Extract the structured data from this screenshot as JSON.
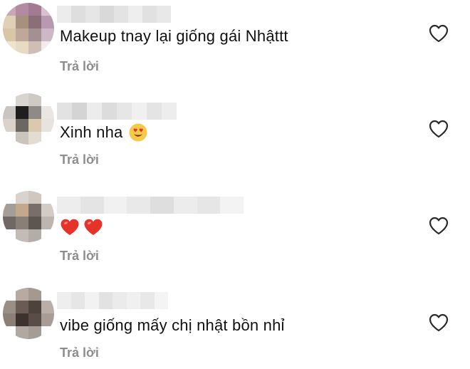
{
  "comments": [
    {
      "text": "Makeup tnay lại giống gái Nhậttt",
      "reply_label": "Trả lời",
      "avatar_colors": [
        "#c9a7b6",
        "#b48aa0",
        "#a27a92",
        "#d9c2cf",
        "#e0d0b8",
        "#a8907e",
        "#8a6f77",
        "#b79ab0",
        "#d8c6a6",
        "#bfa89a",
        "#a48f93",
        "#cdb9c6",
        "#efe5cf",
        "#e7dcc3",
        "#cdbfb5",
        "#f2ebe7"
      ],
      "username_shades": [
        "#ececec",
        "#dedede",
        "#e6e6e6",
        "#d9d9d9",
        "#e3e3e3",
        "#eeeeee",
        "#e1e1e1",
        "#e8e8e8"
      ]
    },
    {
      "text": "Xinh nha",
      "emoji": "heart-eyes",
      "reply_label": "Trả lời",
      "avatar_colors": [
        "#ffffff",
        "#d8d4d0",
        "#cfcac4",
        "#ffffff",
        "#c8c5c2",
        "#1e1e1e",
        "#8f8a86",
        "#e9e6e3",
        "#d9d3cb",
        "#6d6763",
        "#d9c9ad",
        "#e7e3de",
        "#ffffff",
        "#c9c4bd",
        "#e2dcd2",
        "#ffffff"
      ],
      "username_shades": [
        "#e2e2e2",
        "#d4d4d4",
        "#ececec",
        "#dcdcdc",
        "#e6e6e6",
        "#f0f0f0",
        "#e4e4e4",
        "#ededed"
      ]
    },
    {
      "text": "",
      "emoji": "two-red-hearts",
      "reply_label": "Trả lời",
      "avatar_colors": [
        "#ffffff",
        "#d9d3ce",
        "#cfc7c0",
        "#ffffff",
        "#a59d97",
        "#c4a88d",
        "#7a6f68",
        "#d2cbc6",
        "#6f6864",
        "#8a7f77",
        "#5d554f",
        "#bdb5af",
        "#ffffff",
        "#c3bcb6",
        "#b3aca7",
        "#ffffff"
      ],
      "username_shades": [
        "#ededed",
        "#e4e4e4",
        "#f1f1f1",
        "#e9e9e9",
        "#dedede",
        "#ececec",
        "#e6e6e6",
        "#f3f3f3"
      ]
    },
    {
      "text": "vibe giống mấy chị nhật bồn nhỉ",
      "reply_label": "Trả lời",
      "avatar_colors": [
        "#ffffff",
        "#b6aba2",
        "#a39990",
        "#ffffff",
        "#9a8f87",
        "#6a5c54",
        "#4e423c",
        "#b9afa8",
        "#8c7f78",
        "#3d322d",
        "#5a4d47",
        "#a89d96",
        "#ffffff",
        "#b2a8a2",
        "#a59c96",
        "#ffffff"
      ],
      "username_shades": [
        "#eeeeee",
        "#e6e6e6",
        "#f2f2f2",
        "#e2e2e2",
        "#ebebeb",
        "#f0f0f0",
        "#e8e8e8",
        "#f4f4f4"
      ]
    }
  ]
}
